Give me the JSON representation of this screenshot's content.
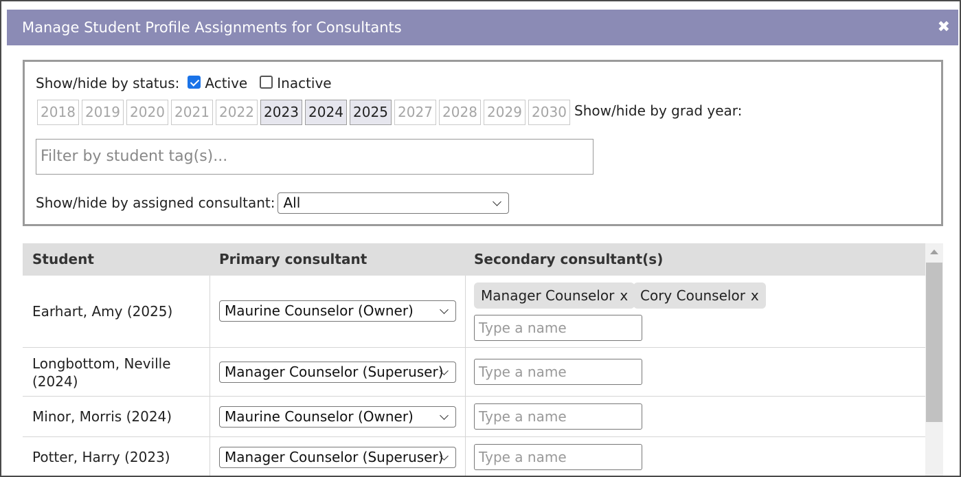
{
  "dialog": {
    "title": "Manage Student Profile Assignments for Consultants",
    "close_icon": "✖"
  },
  "filters": {
    "status_label": "Show/hide by status:",
    "active_label": "Active",
    "active_checked": true,
    "inactive_label": "Inactive",
    "inactive_checked": false,
    "years": [
      {
        "label": "2018",
        "selected": false
      },
      {
        "label": "2019",
        "selected": false
      },
      {
        "label": "2020",
        "selected": false
      },
      {
        "label": "2021",
        "selected": false
      },
      {
        "label": "2022",
        "selected": false
      },
      {
        "label": "2023",
        "selected": true
      },
      {
        "label": "2024",
        "selected": true
      },
      {
        "label": "2025",
        "selected": true
      },
      {
        "label": "2027",
        "selected": false
      },
      {
        "label": "2028",
        "selected": false
      },
      {
        "label": "2029",
        "selected": false
      },
      {
        "label": "2030",
        "selected": false
      }
    ],
    "grad_year_label": "Show/hide by grad year:",
    "tag_placeholder": "Filter by student tag(s)...",
    "consultant_label": "Show/hide by assigned consultant:",
    "consultant_value": "All"
  },
  "table": {
    "headers": [
      "Student",
      "Primary consultant",
      "Secondary consultant(s)"
    ],
    "name_placeholder": "Type a name",
    "rows": [
      {
        "student": "Earhart, Amy (2025)",
        "primary": "Maurine Counselor (Owner)",
        "secondary": [
          "Manager Counselor",
          "Cory Counselor"
        ]
      },
      {
        "student": "Longbottom, Neville (2024)",
        "primary": "Manager Counselor (Superuser)",
        "secondary": []
      },
      {
        "student": "Minor, Morris (2024)",
        "primary": "Maurine Counselor (Owner)",
        "secondary": []
      },
      {
        "student": "Potter, Harry (2023)",
        "primary": "Manager Counselor (Superuser)",
        "secondary": []
      }
    ],
    "chip_remove": "x"
  },
  "colors": {
    "titlebar": "#8b8bb5",
    "checkbox_accent": "#1a73e8"
  }
}
